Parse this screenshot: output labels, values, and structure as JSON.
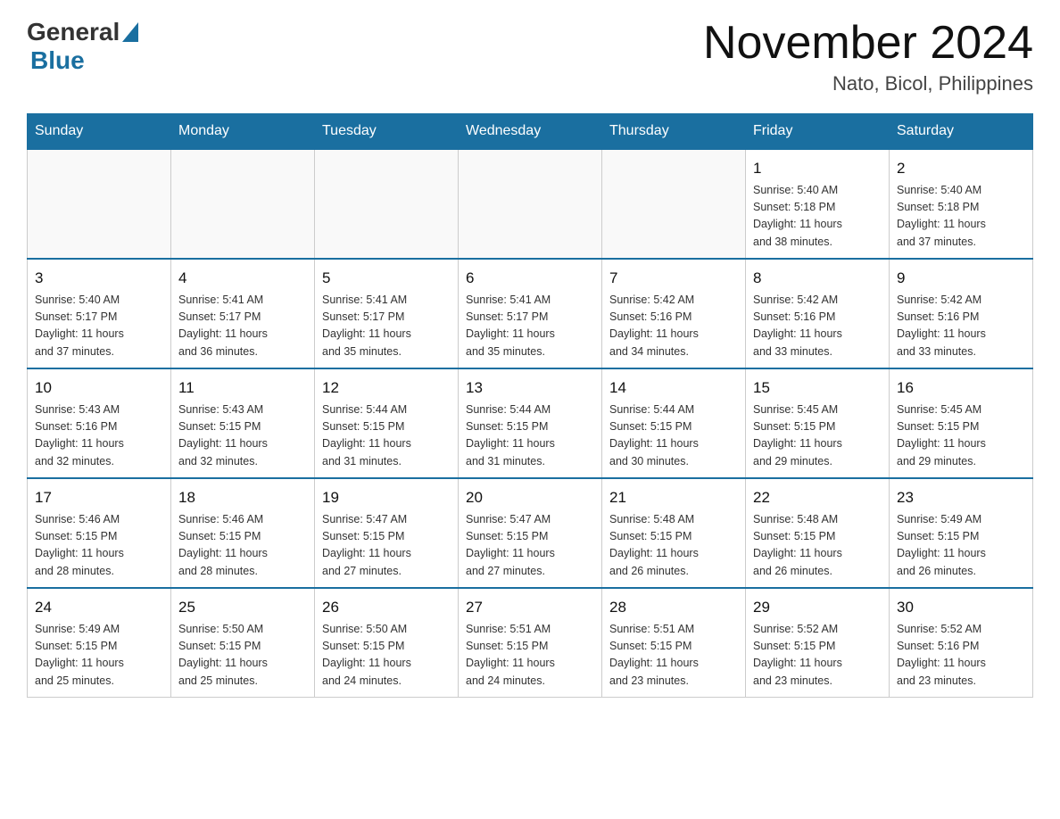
{
  "header": {
    "logo_general": "General",
    "logo_blue": "Blue",
    "month_title": "November 2024",
    "location": "Nato, Bicol, Philippines"
  },
  "weekdays": [
    "Sunday",
    "Monday",
    "Tuesday",
    "Wednesday",
    "Thursday",
    "Friday",
    "Saturday"
  ],
  "weeks": [
    [
      {
        "day": "",
        "info": ""
      },
      {
        "day": "",
        "info": ""
      },
      {
        "day": "",
        "info": ""
      },
      {
        "day": "",
        "info": ""
      },
      {
        "day": "",
        "info": ""
      },
      {
        "day": "1",
        "info": "Sunrise: 5:40 AM\nSunset: 5:18 PM\nDaylight: 11 hours\nand 38 minutes."
      },
      {
        "day": "2",
        "info": "Sunrise: 5:40 AM\nSunset: 5:18 PM\nDaylight: 11 hours\nand 37 minutes."
      }
    ],
    [
      {
        "day": "3",
        "info": "Sunrise: 5:40 AM\nSunset: 5:17 PM\nDaylight: 11 hours\nand 37 minutes."
      },
      {
        "day": "4",
        "info": "Sunrise: 5:41 AM\nSunset: 5:17 PM\nDaylight: 11 hours\nand 36 minutes."
      },
      {
        "day": "5",
        "info": "Sunrise: 5:41 AM\nSunset: 5:17 PM\nDaylight: 11 hours\nand 35 minutes."
      },
      {
        "day": "6",
        "info": "Sunrise: 5:41 AM\nSunset: 5:17 PM\nDaylight: 11 hours\nand 35 minutes."
      },
      {
        "day": "7",
        "info": "Sunrise: 5:42 AM\nSunset: 5:16 PM\nDaylight: 11 hours\nand 34 minutes."
      },
      {
        "day": "8",
        "info": "Sunrise: 5:42 AM\nSunset: 5:16 PM\nDaylight: 11 hours\nand 33 minutes."
      },
      {
        "day": "9",
        "info": "Sunrise: 5:42 AM\nSunset: 5:16 PM\nDaylight: 11 hours\nand 33 minutes."
      }
    ],
    [
      {
        "day": "10",
        "info": "Sunrise: 5:43 AM\nSunset: 5:16 PM\nDaylight: 11 hours\nand 32 minutes."
      },
      {
        "day": "11",
        "info": "Sunrise: 5:43 AM\nSunset: 5:15 PM\nDaylight: 11 hours\nand 32 minutes."
      },
      {
        "day": "12",
        "info": "Sunrise: 5:44 AM\nSunset: 5:15 PM\nDaylight: 11 hours\nand 31 minutes."
      },
      {
        "day": "13",
        "info": "Sunrise: 5:44 AM\nSunset: 5:15 PM\nDaylight: 11 hours\nand 31 minutes."
      },
      {
        "day": "14",
        "info": "Sunrise: 5:44 AM\nSunset: 5:15 PM\nDaylight: 11 hours\nand 30 minutes."
      },
      {
        "day": "15",
        "info": "Sunrise: 5:45 AM\nSunset: 5:15 PM\nDaylight: 11 hours\nand 29 minutes."
      },
      {
        "day": "16",
        "info": "Sunrise: 5:45 AM\nSunset: 5:15 PM\nDaylight: 11 hours\nand 29 minutes."
      }
    ],
    [
      {
        "day": "17",
        "info": "Sunrise: 5:46 AM\nSunset: 5:15 PM\nDaylight: 11 hours\nand 28 minutes."
      },
      {
        "day": "18",
        "info": "Sunrise: 5:46 AM\nSunset: 5:15 PM\nDaylight: 11 hours\nand 28 minutes."
      },
      {
        "day": "19",
        "info": "Sunrise: 5:47 AM\nSunset: 5:15 PM\nDaylight: 11 hours\nand 27 minutes."
      },
      {
        "day": "20",
        "info": "Sunrise: 5:47 AM\nSunset: 5:15 PM\nDaylight: 11 hours\nand 27 minutes."
      },
      {
        "day": "21",
        "info": "Sunrise: 5:48 AM\nSunset: 5:15 PM\nDaylight: 11 hours\nand 26 minutes."
      },
      {
        "day": "22",
        "info": "Sunrise: 5:48 AM\nSunset: 5:15 PM\nDaylight: 11 hours\nand 26 minutes."
      },
      {
        "day": "23",
        "info": "Sunrise: 5:49 AM\nSunset: 5:15 PM\nDaylight: 11 hours\nand 26 minutes."
      }
    ],
    [
      {
        "day": "24",
        "info": "Sunrise: 5:49 AM\nSunset: 5:15 PM\nDaylight: 11 hours\nand 25 minutes."
      },
      {
        "day": "25",
        "info": "Sunrise: 5:50 AM\nSunset: 5:15 PM\nDaylight: 11 hours\nand 25 minutes."
      },
      {
        "day": "26",
        "info": "Sunrise: 5:50 AM\nSunset: 5:15 PM\nDaylight: 11 hours\nand 24 minutes."
      },
      {
        "day": "27",
        "info": "Sunrise: 5:51 AM\nSunset: 5:15 PM\nDaylight: 11 hours\nand 24 minutes."
      },
      {
        "day": "28",
        "info": "Sunrise: 5:51 AM\nSunset: 5:15 PM\nDaylight: 11 hours\nand 23 minutes."
      },
      {
        "day": "29",
        "info": "Sunrise: 5:52 AM\nSunset: 5:15 PM\nDaylight: 11 hours\nand 23 minutes."
      },
      {
        "day": "30",
        "info": "Sunrise: 5:52 AM\nSunset: 5:16 PM\nDaylight: 11 hours\nand 23 minutes."
      }
    ]
  ]
}
